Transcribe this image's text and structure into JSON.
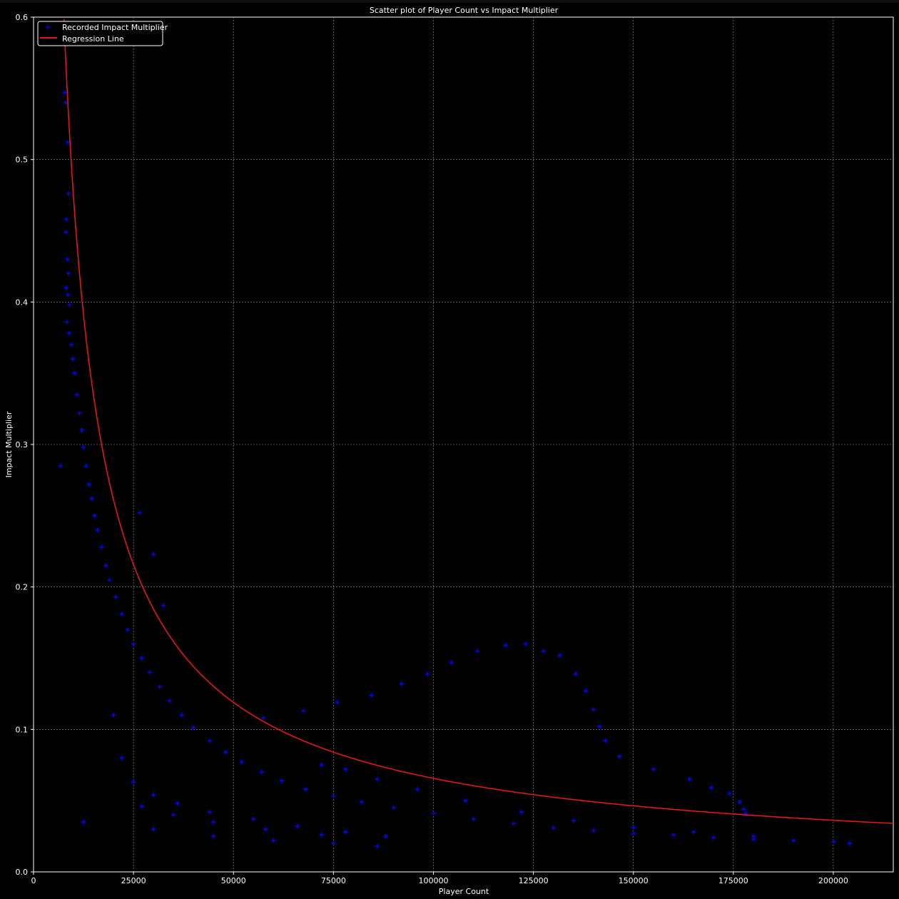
{
  "chart_data": {
    "type": "scatter",
    "title": "Scatter plot of Player Count vs Impact Multiplier",
    "xlabel": "Player Count",
    "ylabel": "Impact Multiplier",
    "xlim": [
      0,
      215000
    ],
    "ylim": [
      0,
      0.6
    ],
    "xticks": [
      0,
      25000,
      50000,
      75000,
      100000,
      125000,
      150000,
      175000,
      200000
    ],
    "yticks": [
      0.0,
      0.1,
      0.2,
      0.3,
      0.4,
      0.5,
      0.6
    ],
    "grid": true,
    "legend_position": "top-left",
    "series": [
      {
        "name": "Recorded Impact Multiplier",
        "kind": "scatter",
        "marker": "plus",
        "color": "#0000ff",
        "points": [
          [
            7800,
            0.547
          ],
          [
            8000,
            0.54
          ],
          [
            8500,
            0.512
          ],
          [
            8700,
            0.476
          ],
          [
            8200,
            0.458
          ],
          [
            8000,
            0.449
          ],
          [
            8400,
            0.43
          ],
          [
            8700,
            0.42
          ],
          [
            8200,
            0.41
          ],
          [
            8600,
            0.405
          ],
          [
            9000,
            0.398
          ],
          [
            8300,
            0.386
          ],
          [
            8900,
            0.378
          ],
          [
            9400,
            0.37
          ],
          [
            9800,
            0.36
          ],
          [
            10200,
            0.35
          ],
          [
            10800,
            0.335
          ],
          [
            11500,
            0.322
          ],
          [
            12000,
            0.31
          ],
          [
            12500,
            0.298
          ],
          [
            13200,
            0.285
          ],
          [
            13800,
            0.272
          ],
          [
            14500,
            0.262
          ],
          [
            15200,
            0.25
          ],
          [
            16000,
            0.24
          ],
          [
            17000,
            0.228
          ],
          [
            18000,
            0.215
          ],
          [
            19000,
            0.205
          ],
          [
            20500,
            0.193
          ],
          [
            22000,
            0.181
          ],
          [
            23500,
            0.17
          ],
          [
            25000,
            0.16
          ],
          [
            27000,
            0.15
          ],
          [
            29000,
            0.14
          ],
          [
            31500,
            0.13
          ],
          [
            34000,
            0.12
          ],
          [
            37000,
            0.11
          ],
          [
            40000,
            0.101
          ],
          [
            44000,
            0.092
          ],
          [
            48000,
            0.084
          ],
          [
            52000,
            0.077
          ],
          [
            57000,
            0.07
          ],
          [
            62000,
            0.064
          ],
          [
            68000,
            0.058
          ],
          [
            75000,
            0.053
          ],
          [
            82000,
            0.049
          ],
          [
            90000,
            0.045
          ],
          [
            100000,
            0.041
          ],
          [
            110000,
            0.037
          ],
          [
            120000,
            0.034
          ],
          [
            130000,
            0.031
          ],
          [
            140000,
            0.029
          ],
          [
            150000,
            0.027
          ],
          [
            160000,
            0.026
          ],
          [
            170000,
            0.024
          ],
          [
            180000,
            0.023
          ],
          [
            190000,
            0.022
          ],
          [
            200000,
            0.021
          ],
          [
            204000,
            0.02
          ],
          [
            6800,
            0.285
          ],
          [
            12500,
            0.035
          ],
          [
            26500,
            0.252
          ],
          [
            30000,
            0.223
          ],
          [
            32500,
            0.187
          ],
          [
            57500,
            0.108
          ],
          [
            67500,
            0.113
          ],
          [
            76000,
            0.119
          ],
          [
            84500,
            0.124
          ],
          [
            92000,
            0.132
          ],
          [
            98500,
            0.139
          ],
          [
            104500,
            0.147
          ],
          [
            111000,
            0.155
          ],
          [
            118000,
            0.159
          ],
          [
            123000,
            0.16
          ],
          [
            127500,
            0.155
          ],
          [
            131500,
            0.152
          ],
          [
            135500,
            0.139
          ],
          [
            138000,
            0.127
          ],
          [
            140000,
            0.114
          ],
          [
            141500,
            0.102
          ],
          [
            143000,
            0.092
          ],
          [
            146500,
            0.081
          ],
          [
            155000,
            0.072
          ],
          [
            164000,
            0.065
          ],
          [
            169500,
            0.059
          ],
          [
            174000,
            0.055
          ],
          [
            176500,
            0.049
          ],
          [
            177500,
            0.044
          ],
          [
            178000,
            0.041
          ],
          [
            72000,
            0.075
          ],
          [
            78000,
            0.072
          ],
          [
            86000,
            0.065
          ],
          [
            96000,
            0.058
          ],
          [
            108000,
            0.05
          ],
          [
            122000,
            0.042
          ],
          [
            135000,
            0.036
          ],
          [
            150000,
            0.031
          ],
          [
            165000,
            0.028
          ],
          [
            180000,
            0.025
          ],
          [
            20000,
            0.11
          ],
          [
            22000,
            0.08
          ],
          [
            25000,
            0.063
          ],
          [
            30000,
            0.054
          ],
          [
            36000,
            0.048
          ],
          [
            44000,
            0.042
          ],
          [
            55000,
            0.037
          ],
          [
            66000,
            0.032
          ],
          [
            78000,
            0.028
          ],
          [
            88000,
            0.025
          ],
          [
            27000,
            0.046
          ],
          [
            35000,
            0.04
          ],
          [
            45000,
            0.035
          ],
          [
            58000,
            0.03
          ],
          [
            72000,
            0.026
          ],
          [
            30000,
            0.03
          ],
          [
            45000,
            0.025
          ],
          [
            60000,
            0.022
          ],
          [
            75000,
            0.02
          ],
          [
            86000,
            0.018
          ]
        ]
      },
      {
        "name": "Regression Line",
        "kind": "line",
        "color": "#e01818",
        "model": "y = a / x^b",
        "a": 1280,
        "b": 0.858,
        "x_range": [
          6500,
          215000
        ]
      }
    ]
  }
}
